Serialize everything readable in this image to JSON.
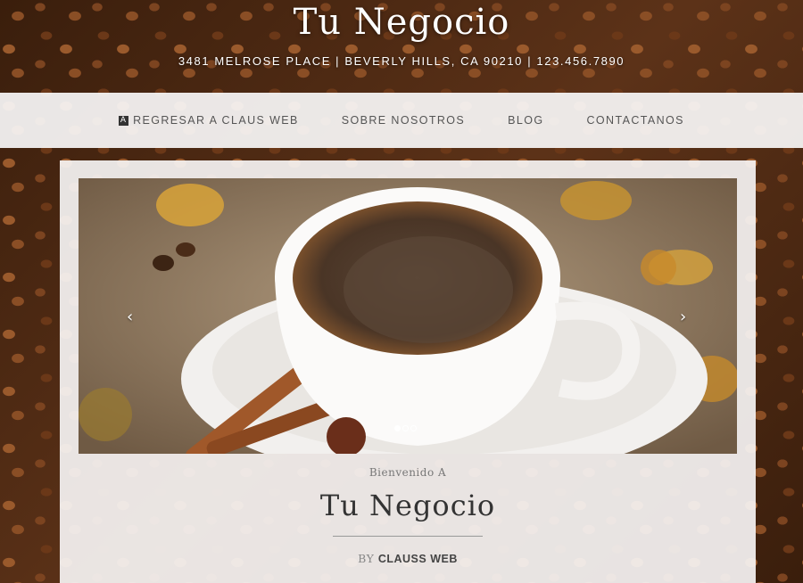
{
  "header": {
    "title": "Tu Negocio",
    "address": "3481 MELROSE PLACE | BEVERLY HILLS, CA 90210 | 123.456.7890"
  },
  "nav": {
    "items": [
      {
        "label": "REGRESAR A CLAUS WEB",
        "icon": "claus-web-icon"
      },
      {
        "label": "SOBRE NOSOTROS"
      },
      {
        "label": "BLOG"
      },
      {
        "label": "CONTACTANOS"
      }
    ]
  },
  "slider": {
    "prev_arrow": "‹",
    "next_arrow": "›",
    "slide_count": 3,
    "active_slide": 1
  },
  "welcome": {
    "subtitle": "Bienvenido A",
    "title": "Tu Negocio",
    "byline_prefix": "BY",
    "byline_author": "CLAUSS WEB"
  },
  "colors": {
    "nav_bg": "#f8f6f6",
    "nav_text": "#555555",
    "title_text": "#333333",
    "header_text": "#ffffff"
  }
}
